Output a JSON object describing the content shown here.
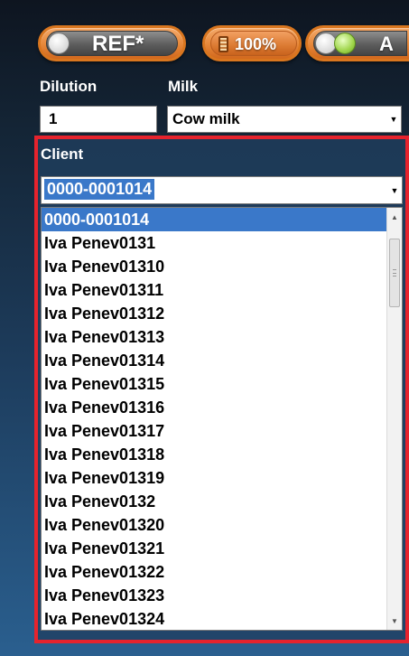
{
  "toolbar": {
    "ref_label": "REF*",
    "zoom_label": "100%",
    "a_label": "A"
  },
  "form": {
    "dilution_label": "Dilution",
    "dilution_value": "1",
    "milk_label": "Milk",
    "milk_value": "Cow milk",
    "client_label": "Client",
    "client_value": "0000-0001014"
  },
  "client_options": [
    "0000-0001014",
    "Iva Penev0131",
    "Iva Penev01310",
    "Iva Penev01311",
    "Iva Penev01312",
    "Iva Penev01313",
    "Iva Penev01314",
    "Iva Penev01315",
    "Iva Penev01316",
    "Iva Penev01317",
    "Iva Penev01318",
    "Iva Penev01319",
    "Iva Penev0132",
    "Iva Penev01320",
    "Iva Penev01321",
    "Iva Penev01322",
    "Iva Penev01323",
    "Iva Penev01324"
  ],
  "selected_index": 0,
  "colors": {
    "highlight_frame": "#e6232d",
    "selection": "#3a78c9",
    "button_orange": "#e88a3c"
  },
  "icons": {
    "dropdown": "chevron-down-icon",
    "scroll_up": "arrow-up-icon",
    "scroll_down": "arrow-down-icon"
  }
}
